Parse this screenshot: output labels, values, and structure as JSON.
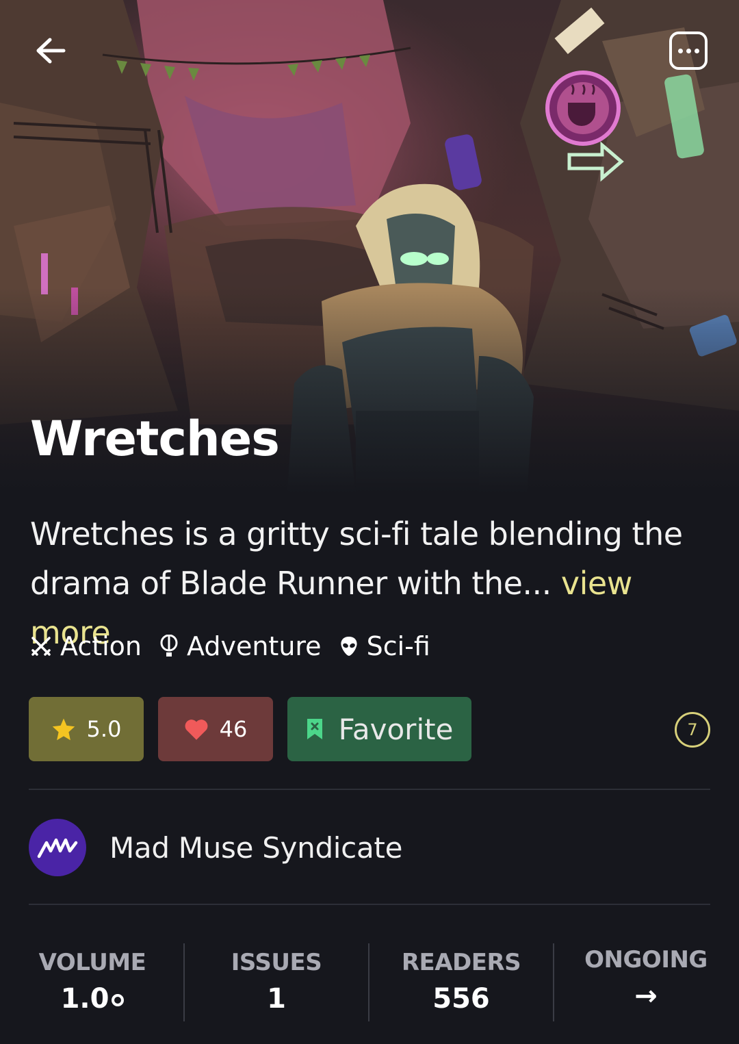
{
  "header": {
    "back_icon": "arrow-left-icon",
    "more_icon": "ellipsis-icon"
  },
  "comic": {
    "title": "Wretches",
    "description": "Wretches is a gritty sci-fi tale blending the drama of Blade Runner with the...",
    "view_more": "view more"
  },
  "genres": [
    {
      "label": "Action",
      "icon": "crossed-swords-icon"
    },
    {
      "label": "Adventure",
      "icon": "hot-air-balloon-icon"
    },
    {
      "label": "Sci-fi",
      "icon": "alien-icon"
    }
  ],
  "actions": {
    "rating": "5.0",
    "likes": "46",
    "favorite_label": "Favorite",
    "count_badge": "7"
  },
  "publisher": {
    "name": "Mad Muse Syndicate"
  },
  "stats": {
    "volume_label": "VOLUME",
    "volume_value": "1.0",
    "issues_label": "ISSUES",
    "issues_value": "1",
    "readers_label": "READERS",
    "readers_value": "556",
    "status_label": "ONGOING",
    "status_arrow": "→"
  },
  "colors": {
    "background": "#16171d",
    "rating_bg": "#716e36",
    "likes_bg": "#6d3a3a",
    "favorite_bg": "#2b6344",
    "accent_yellow": "#e9e38f",
    "publisher_bg": "#4a24a6"
  }
}
